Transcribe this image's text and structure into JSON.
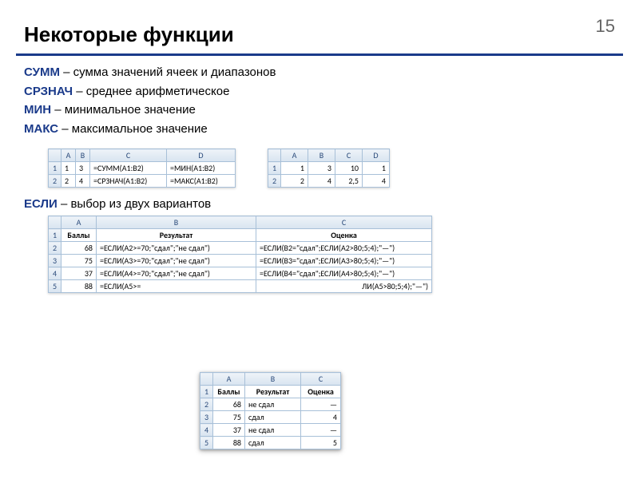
{
  "slide_number": "15",
  "title": "Некоторые функции",
  "definitions": [
    {
      "name": "СУММ",
      "desc": " – сумма значений ячеек и диапазонов"
    },
    {
      "name": "СРЗНАЧ",
      "desc": " – среднее арифметическое"
    },
    {
      "name": "МИН",
      "desc": " – минимальное значение"
    },
    {
      "name": "МАКС",
      "desc": " – максимальное значение"
    }
  ],
  "table1": {
    "cols": [
      "A",
      "B",
      "C",
      "D"
    ],
    "rows": [
      {
        "h": "1",
        "a": "1",
        "b": "3",
        "c": "=СУММ(A1:B2)",
        "d": "=МИН(A1:B2)"
      },
      {
        "h": "2",
        "a": "2",
        "b": "4",
        "c": "=СРЗНАЧ(A1:B2)",
        "d": "=МАКС(A1:B2)"
      }
    ]
  },
  "table2": {
    "cols": [
      "A",
      "B",
      "C",
      "D"
    ],
    "rows": [
      {
        "h": "1",
        "a": "1",
        "b": "3",
        "c": "10",
        "d": "1"
      },
      {
        "h": "2",
        "a": "2",
        "b": "4",
        "c": "2,5",
        "d": "4"
      }
    ]
  },
  "if_heading": {
    "name": "ЕСЛИ",
    "desc": " – выбор из двух вариантов"
  },
  "table3": {
    "cols": [
      "A",
      "B",
      "C"
    ],
    "header_row": {
      "h": "1",
      "a": "Баллы",
      "b": "Результат",
      "c": "Оценка"
    },
    "rows": [
      {
        "h": "2",
        "a": "68",
        "b": "=ЕСЛИ(A2>=70;\"сдал\";\"не сдал\")",
        "c": "=ЕСЛИ(B2=\"сдал\";ЕСЛИ(A2>80;5;4);\"—\")"
      },
      {
        "h": "3",
        "a": "75",
        "b": "=ЕСЛИ(A3>=70;\"сдал\";\"не сдал\")",
        "c": "=ЕСЛИ(B3=\"сдал\";ЕСЛИ(A3>80;5;4);\"—\")"
      },
      {
        "h": "4",
        "a": "37",
        "b": "=ЕСЛИ(A4>=70;\"сдал\";\"не сдал\")",
        "c": "=ЕСЛИ(B4=\"сдал\";ЕСЛИ(A4>80;5;4);\"—\")"
      },
      {
        "h": "5",
        "a": "88",
        "b": "=ЕСЛИ(A5>=",
        "c": "ЛИ(A5>80;5;4);\"—\")"
      }
    ]
  },
  "table4": {
    "cols": [
      "A",
      "B",
      "C"
    ],
    "header_row": {
      "h": "1",
      "a": "Баллы",
      "b": "Результат",
      "c": "Оценка"
    },
    "rows": [
      {
        "h": "2",
        "a": "68",
        "b": "не сдал",
        "c": "—"
      },
      {
        "h": "3",
        "a": "75",
        "b": "сдал",
        "c": "4"
      },
      {
        "h": "4",
        "a": "37",
        "b": "не сдал",
        "c": "—"
      },
      {
        "h": "5",
        "a": "88",
        "b": "сдал",
        "c": "5"
      }
    ]
  }
}
